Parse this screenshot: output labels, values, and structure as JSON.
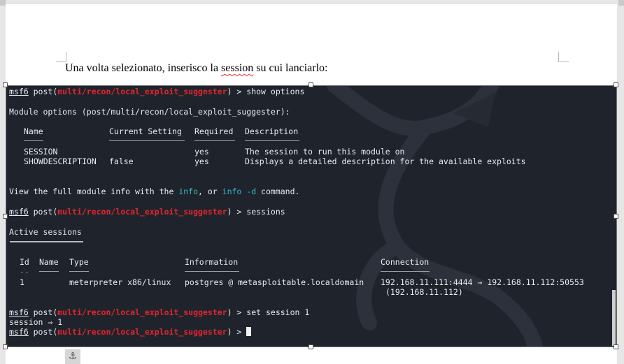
{
  "document": {
    "paragraph": "Una volta selezionato, inserisco la ",
    "squiggle_word": "session",
    "paragraph_end": " su cui lanciarlo:"
  },
  "terminal": {
    "prompt_prefix": "msf6",
    "prompt_post": " post(",
    "module_path": "multi/recon/local_exploit_suggester",
    "prompt_suffix": ") > ",
    "cmd1": "show options",
    "module_options_heading": "Module options (post/multi/recon/local_exploit_suggester):",
    "options_headers": {
      "name": "Name",
      "current_setting": "Current Setting",
      "required": "Required",
      "description": "Description"
    },
    "options_rows": [
      {
        "name": "SESSION",
        "current": "",
        "required": "yes",
        "description": "The session to run this module on"
      },
      {
        "name": "SHOWDESCRIPTION",
        "current": "false",
        "required": "yes",
        "description": "Displays a detailed description for the available exploits"
      }
    ],
    "info_text_1": "View the full module info with the ",
    "info_link_1": "info",
    "info_text_2": ", or ",
    "info_link_2": "info -d",
    "info_text_3": " command.",
    "cmd2": "sessions",
    "active_sessions_heading": "Active sessions",
    "sessions_headers": {
      "id": "Id",
      "name": "Name",
      "type": "Type",
      "information": "Information",
      "connection": "Connection"
    },
    "sessions_dash_id": "--",
    "sessions_row": {
      "id": "1",
      "name": "",
      "type": "meterpreter x86/linux",
      "information": "postgres @ metasploitable.localdomain",
      "connection": "192.168.11.111:4444 → 192.168.11.112:50553",
      "connection_cont": "(192.168.11.112)"
    },
    "cmd3": "set session 1",
    "set_result": "session ⇒ 1"
  },
  "icons": {
    "anchor": "anchor-icon"
  }
}
